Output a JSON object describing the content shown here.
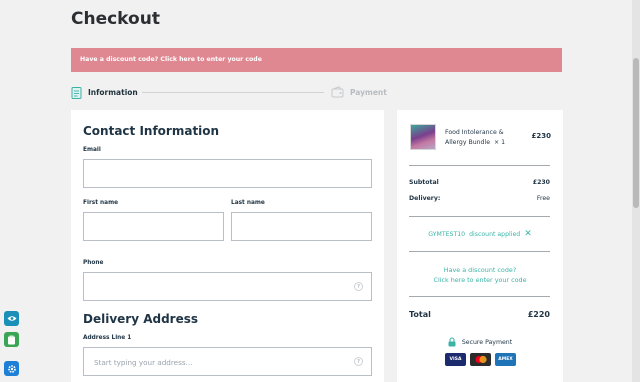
{
  "page": {
    "title": "Checkout"
  },
  "discount_banner": {
    "text": "Have a discount code? Click here to enter your code"
  },
  "steps": [
    {
      "label": "Information",
      "icon": "clipboard-icon"
    },
    {
      "label": "Payment",
      "icon": "wallet-icon"
    }
  ],
  "contact": {
    "title": "Contact Information",
    "email_label": "Email",
    "first_name_label": "First name",
    "last_name_label": "Last name",
    "phone_label": "Phone"
  },
  "delivery": {
    "title": "Delivery Address",
    "address1_label": "Address Line 1",
    "address1_placeholder": "Start typing your address..."
  },
  "summary": {
    "product_name": "Food Intolerance & Allergy Bundle",
    "product_qty": "× 1",
    "product_price": "£230",
    "subtotal_label": "Subtotal",
    "subtotal_value": "£230",
    "delivery_label": "Delivery:",
    "delivery_value": "Free",
    "code": "GYMTEST10",
    "code_status": "discount applied",
    "discount_question": "Have a discount code?",
    "discount_link": "Click here to enter your code",
    "total_label": "Total",
    "total_value": "£220",
    "secure_label": "Secure Payment",
    "cards": [
      "VISA",
      "MC",
      "AMEX"
    ]
  },
  "colors": {
    "banner": "#e08891",
    "accent": "#3bb4a8",
    "heading": "#1f3444",
    "side_buttons": [
      "#1a8fb8",
      "#3aa655",
      "#1e7fd6"
    ]
  }
}
